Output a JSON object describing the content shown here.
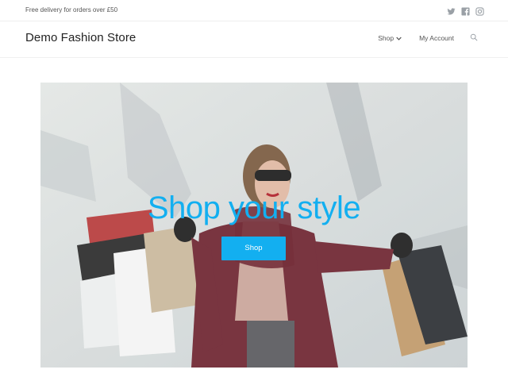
{
  "topbar": {
    "text": "Free delivery for orders over £50",
    "social": [
      {
        "icon": "twitter-icon"
      },
      {
        "icon": "facebook-icon"
      },
      {
        "icon": "instagram-icon"
      }
    ]
  },
  "header": {
    "site_title": "Demo Fashion Store",
    "nav": {
      "shop_label": "Shop",
      "account_label": "My Account",
      "search_icon": "search-icon"
    }
  },
  "hero": {
    "heading": "Shop your style",
    "button_label": "Shop",
    "image_description_icon": "hero-image"
  },
  "colors": {
    "accent": "#13aff0",
    "text": "#333333"
  }
}
